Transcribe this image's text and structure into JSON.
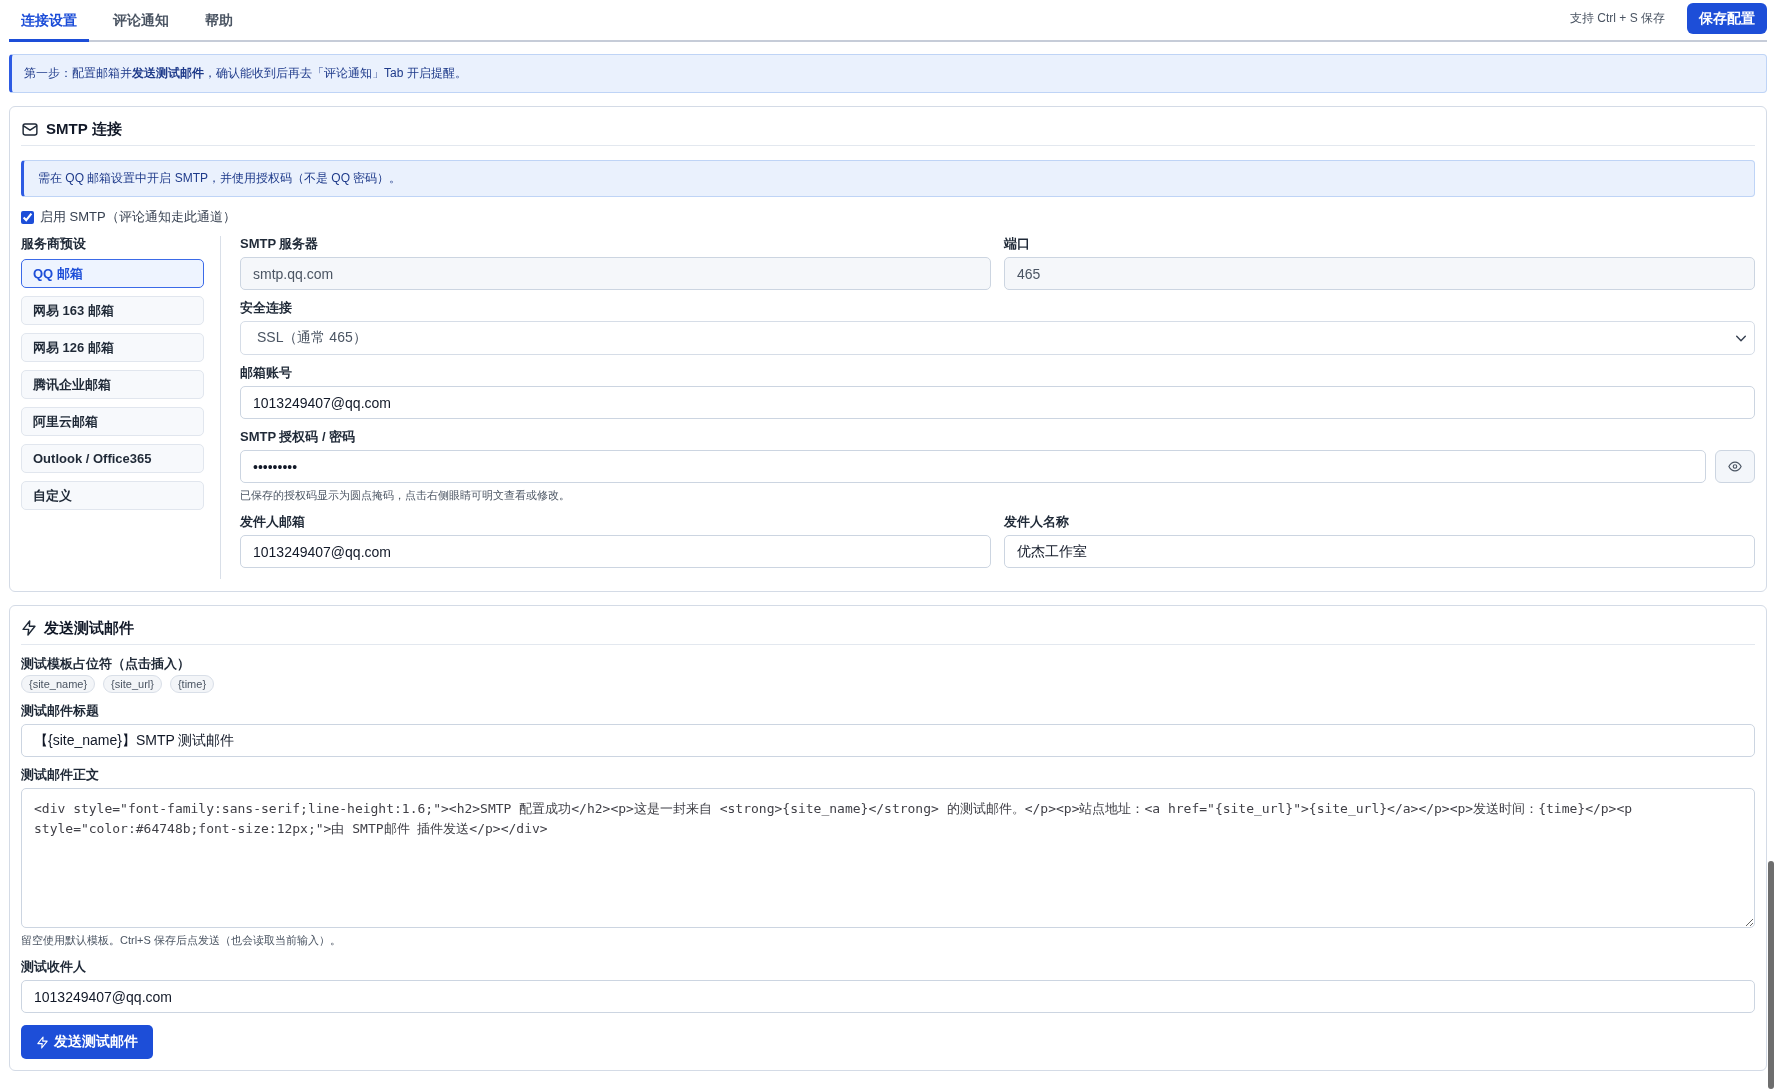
{
  "tabs": [
    {
      "label": "连接设置",
      "selected": true
    },
    {
      "label": "评论通知",
      "selected": false
    },
    {
      "label": "帮助",
      "selected": false
    }
  ],
  "toolbar": {
    "hint": "支持 Ctrl + S 保存",
    "save_button": "保存配置"
  },
  "notice": "第一步：配置邮箱并**发送测试邮件**，确认能收到后再去「评论通知」Tab 开启提醒。",
  "smtp_card": {
    "title": "SMTP 连接",
    "info": "需在 QQ 邮箱设置中开启 SMTP，并使用授权码（不是 QQ 密码）。",
    "enable": {
      "label": "启用 SMTP（评论通知走此通道）",
      "checked": true
    },
    "presets": {
      "label": "服务商预设",
      "items": [
        {
          "label": "QQ 邮箱",
          "selected": true
        },
        {
          "label": "网易 163 邮箱",
          "selected": false
        },
        {
          "label": "网易 126 邮箱",
          "selected": false
        },
        {
          "label": "腾讯企业邮箱",
          "selected": false
        },
        {
          "label": "阿里云邮箱",
          "selected": false
        },
        {
          "label": "Outlook / Office365",
          "selected": false
        },
        {
          "label": "自定义",
          "selected": false
        }
      ]
    },
    "field_rows": [
      [
        {
          "kind": "text",
          "label": "SMTP 服务器",
          "value": "smtp.qq.com",
          "readonly": true
        },
        {
          "kind": "text",
          "label": "端口",
          "value": "465",
          "readonly": true
        }
      ],
      [
        {
          "kind": "select",
          "label": "安全连接",
          "value": "SSL（通常 465）"
        }
      ],
      [
        {
          "kind": "text",
          "label": "邮箱账号",
          "value": "1013249407@qq.com",
          "readonly": false
        }
      ],
      [
        {
          "kind": "password",
          "label": "SMTP 授权码 / 密码",
          "value": "•••••••••",
          "hint": "已保存的授权码显示为圆点掩码，点击右侧眼睛可明文查看或修改。"
        }
      ],
      [
        {
          "kind": "text",
          "label": "发件人邮箱",
          "value": "1013249407@qq.com",
          "readonly": false
        },
        {
          "kind": "text",
          "label": "发件人名称",
          "value": "优杰工作室",
          "readonly": false
        }
      ]
    ]
  },
  "test_card": {
    "title": "发送测试邮件",
    "placeholders": {
      "label": "测试模板占位符（点击插入）",
      "items": [
        "{site_name}",
        "{site_url}",
        "{time}"
      ]
    },
    "subject": {
      "label": "测试邮件标题",
      "value": "【{site_name}】SMTP 测试邮件"
    },
    "body": {
      "label": "测试邮件正文",
      "value": "<div style=\"font-family:sans-serif;line-height:1.6;\"><h2>SMTP 配置成功</h2><p>这是一封来自 <strong>{site_name}</strong> 的测试邮件。</p><p>站点地址：<a href=\"{site_url}\">{site_url}</a></p><p>发送时间：{time}</p><p style=\"color:#64748b;font-size:12px;\">由 SMTP邮件 插件发送</p></div>",
      "hint": "留空使用默认模板。Ctrl+S 保存后点发送（也会读取当前输入）。"
    },
    "recipient": {
      "label": "测试收件人",
      "value": "1013249407@qq.com"
    },
    "send_button": "发送测试邮件"
  }
}
